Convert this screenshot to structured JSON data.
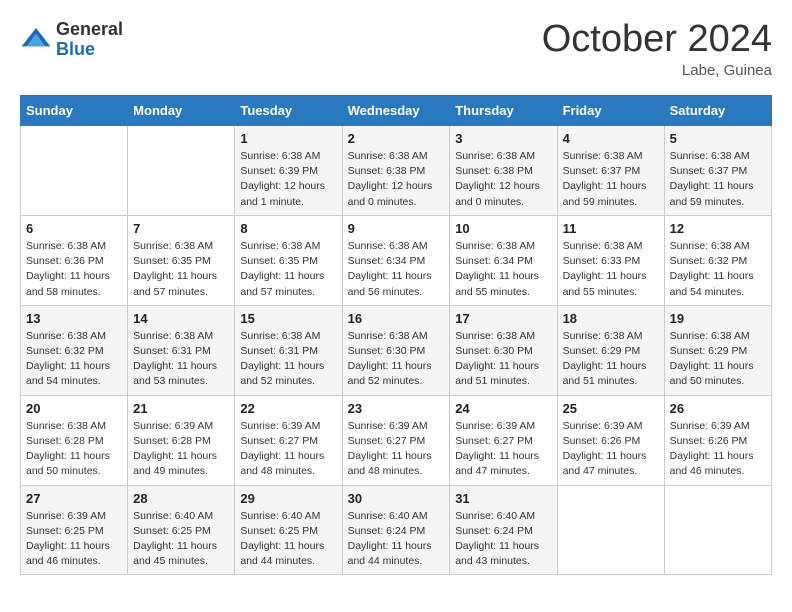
{
  "logo": {
    "general": "General",
    "blue": "Blue"
  },
  "title": "October 2024",
  "location": "Labe, Guinea",
  "days_of_week": [
    "Sunday",
    "Monday",
    "Tuesday",
    "Wednesday",
    "Thursday",
    "Friday",
    "Saturday"
  ],
  "weeks": [
    [
      {
        "day": "",
        "info": ""
      },
      {
        "day": "",
        "info": ""
      },
      {
        "day": "1",
        "info": "Sunrise: 6:38 AM\nSunset: 6:39 PM\nDaylight: 12 hours and 1 minute."
      },
      {
        "day": "2",
        "info": "Sunrise: 6:38 AM\nSunset: 6:38 PM\nDaylight: 12 hours and 0 minutes."
      },
      {
        "day": "3",
        "info": "Sunrise: 6:38 AM\nSunset: 6:38 PM\nDaylight: 12 hours and 0 minutes."
      },
      {
        "day": "4",
        "info": "Sunrise: 6:38 AM\nSunset: 6:37 PM\nDaylight: 11 hours and 59 minutes."
      },
      {
        "day": "5",
        "info": "Sunrise: 6:38 AM\nSunset: 6:37 PM\nDaylight: 11 hours and 59 minutes."
      }
    ],
    [
      {
        "day": "6",
        "info": "Sunrise: 6:38 AM\nSunset: 6:36 PM\nDaylight: 11 hours and 58 minutes."
      },
      {
        "day": "7",
        "info": "Sunrise: 6:38 AM\nSunset: 6:35 PM\nDaylight: 11 hours and 57 minutes."
      },
      {
        "day": "8",
        "info": "Sunrise: 6:38 AM\nSunset: 6:35 PM\nDaylight: 11 hours and 57 minutes."
      },
      {
        "day": "9",
        "info": "Sunrise: 6:38 AM\nSunset: 6:34 PM\nDaylight: 11 hours and 56 minutes."
      },
      {
        "day": "10",
        "info": "Sunrise: 6:38 AM\nSunset: 6:34 PM\nDaylight: 11 hours and 55 minutes."
      },
      {
        "day": "11",
        "info": "Sunrise: 6:38 AM\nSunset: 6:33 PM\nDaylight: 11 hours and 55 minutes."
      },
      {
        "day": "12",
        "info": "Sunrise: 6:38 AM\nSunset: 6:32 PM\nDaylight: 11 hours and 54 minutes."
      }
    ],
    [
      {
        "day": "13",
        "info": "Sunrise: 6:38 AM\nSunset: 6:32 PM\nDaylight: 11 hours and 54 minutes."
      },
      {
        "day": "14",
        "info": "Sunrise: 6:38 AM\nSunset: 6:31 PM\nDaylight: 11 hours and 53 minutes."
      },
      {
        "day": "15",
        "info": "Sunrise: 6:38 AM\nSunset: 6:31 PM\nDaylight: 11 hours and 52 minutes."
      },
      {
        "day": "16",
        "info": "Sunrise: 6:38 AM\nSunset: 6:30 PM\nDaylight: 11 hours and 52 minutes."
      },
      {
        "day": "17",
        "info": "Sunrise: 6:38 AM\nSunset: 6:30 PM\nDaylight: 11 hours and 51 minutes."
      },
      {
        "day": "18",
        "info": "Sunrise: 6:38 AM\nSunset: 6:29 PM\nDaylight: 11 hours and 51 minutes."
      },
      {
        "day": "19",
        "info": "Sunrise: 6:38 AM\nSunset: 6:29 PM\nDaylight: 11 hours and 50 minutes."
      }
    ],
    [
      {
        "day": "20",
        "info": "Sunrise: 6:38 AM\nSunset: 6:28 PM\nDaylight: 11 hours and 50 minutes."
      },
      {
        "day": "21",
        "info": "Sunrise: 6:39 AM\nSunset: 6:28 PM\nDaylight: 11 hours and 49 minutes."
      },
      {
        "day": "22",
        "info": "Sunrise: 6:39 AM\nSunset: 6:27 PM\nDaylight: 11 hours and 48 minutes."
      },
      {
        "day": "23",
        "info": "Sunrise: 6:39 AM\nSunset: 6:27 PM\nDaylight: 11 hours and 48 minutes."
      },
      {
        "day": "24",
        "info": "Sunrise: 6:39 AM\nSunset: 6:27 PM\nDaylight: 11 hours and 47 minutes."
      },
      {
        "day": "25",
        "info": "Sunrise: 6:39 AM\nSunset: 6:26 PM\nDaylight: 11 hours and 47 minutes."
      },
      {
        "day": "26",
        "info": "Sunrise: 6:39 AM\nSunset: 6:26 PM\nDaylight: 11 hours and 46 minutes."
      }
    ],
    [
      {
        "day": "27",
        "info": "Sunrise: 6:39 AM\nSunset: 6:25 PM\nDaylight: 11 hours and 46 minutes."
      },
      {
        "day": "28",
        "info": "Sunrise: 6:40 AM\nSunset: 6:25 PM\nDaylight: 11 hours and 45 minutes."
      },
      {
        "day": "29",
        "info": "Sunrise: 6:40 AM\nSunset: 6:25 PM\nDaylight: 11 hours and 44 minutes."
      },
      {
        "day": "30",
        "info": "Sunrise: 6:40 AM\nSunset: 6:24 PM\nDaylight: 11 hours and 44 minutes."
      },
      {
        "day": "31",
        "info": "Sunrise: 6:40 AM\nSunset: 6:24 PM\nDaylight: 11 hours and 43 minutes."
      },
      {
        "day": "",
        "info": ""
      },
      {
        "day": "",
        "info": ""
      }
    ]
  ]
}
